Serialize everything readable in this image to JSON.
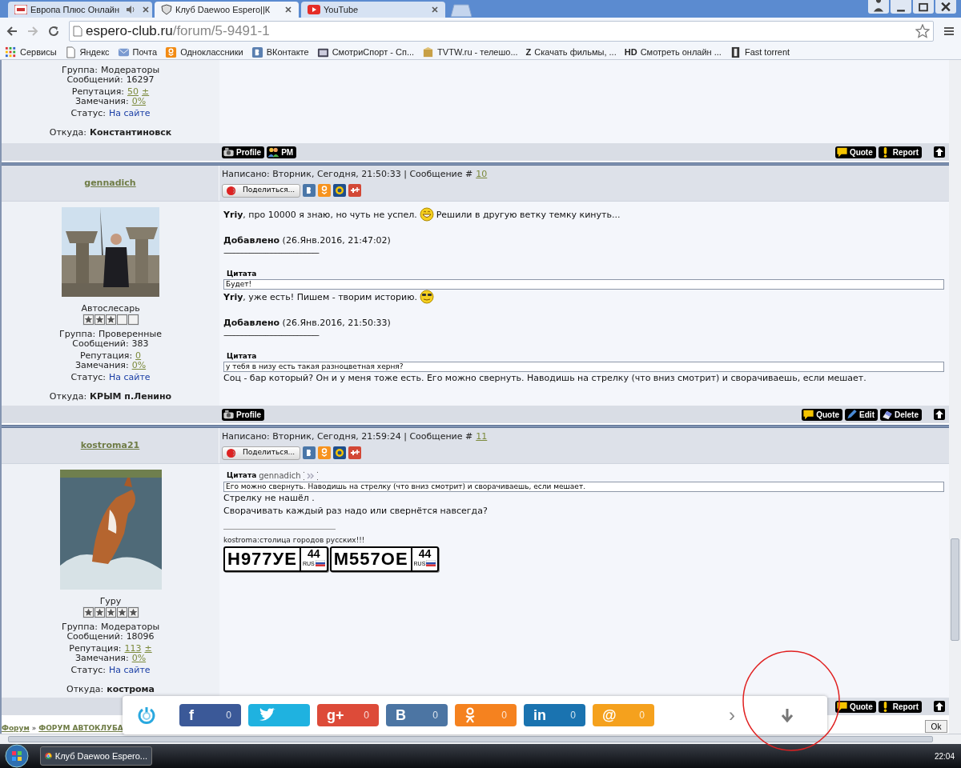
{
  "browser": {
    "tabs": [
      {
        "title": "Европа Плюс Онлайн",
        "kind": "europa",
        "audio": true,
        "selected": false
      },
      {
        "title": "Клуб Daewoo Espero||К",
        "kind": "shield",
        "audio": false,
        "selected": true
      },
      {
        "title": "YouTube",
        "kind": "youtube",
        "audio": false,
        "selected": false
      }
    ],
    "address": {
      "domain": "espero-club.ru",
      "path": "/forum/5-9491-1"
    },
    "bookmarks": [
      {
        "label": "Сервисы",
        "kind": "apps"
      },
      {
        "label": "Яндекс",
        "kind": "page"
      },
      {
        "label": "Почта",
        "kind": "mail"
      },
      {
        "label": "Одноклассники",
        "kind": "ok"
      },
      {
        "label": "ВКонтакте",
        "kind": "vk"
      },
      {
        "label": "СмотриСпорт - Сп...",
        "kind": "tv"
      },
      {
        "label": "TVTW.ru - телешо...",
        "kind": "box"
      },
      {
        "label": "Скачать фильмы, ...",
        "glyph": "Z"
      },
      {
        "label": "Смотреть онлайн ...",
        "glyph": "HD"
      },
      {
        "label": "Fast torrent",
        "kind": "film"
      }
    ]
  },
  "posts": [
    {
      "profile": {
        "fields": [
          [
            {
              "label": "Группа:",
              "value": "Модераторы",
              "kind": "plain"
            },
            {
              "label": "Сообщений:",
              "value": "16297",
              "kind": "plain"
            }
          ],
          [
            {
              "label": "Репутация:",
              "value": "50",
              "suffix": "±",
              "kind": "link"
            },
            {
              "label": "Замечания:",
              "value": "0%",
              "kind": "link"
            }
          ],
          [
            {
              "label": "Статус:",
              "value": "На сайте",
              "kind": "status"
            }
          ],
          [
            {
              "label": "Откуда:",
              "value": "Константиновск",
              "kind": "bold"
            }
          ]
        ]
      },
      "left_actions": [
        {
          "label": "Profile",
          "kind": "profile"
        },
        {
          "label": "PM",
          "kind": "pm"
        }
      ],
      "right_actions": [
        {
          "label": "Quote",
          "kind": "quote"
        },
        {
          "label": "Report",
          "kind": "report"
        }
      ]
    },
    {
      "author": "gennadich",
      "posted": "Написано: Вторник, Сегодня, 21:50:33 | Сообщение #",
      "number": "10",
      "share": "Поделиться...",
      "profile": {
        "avatar": {
          "kind": "picture"
        },
        "rank": "Автослесарь",
        "stars": 3,
        "fields": [
          [
            {
              "label": "Группа:",
              "value": "Проверенные",
              "kind": "plain"
            },
            {
              "label": "Сообщений:",
              "value": "383",
              "kind": "plain"
            }
          ],
          [
            {
              "label": "Репутация:",
              "value": "0",
              "kind": "link"
            },
            {
              "label": "Замечания:",
              "value": "0%",
              "kind": "link"
            }
          ],
          [
            {
              "label": "Статус:",
              "value": "На сайте",
              "kind": "status"
            }
          ],
          [
            {
              "label": "Откуда:",
              "value": "КРЫМ п.Ленино",
              "kind": "bold"
            }
          ]
        ]
      },
      "content": [
        {
          "kind": "text",
          "text": "**Yriy**, про 10000 я знаю, но чуть не успел.",
          "smiley": true,
          "tail": "Решили в другую ветку темку кинуть..."
        },
        {
          "kind": "added",
          "label": "Добавлено",
          "date": "(26.Янв.2016, 21:47:02)"
        },
        {
          "kind": "dashes",
          "text": "------------------------------------------------"
        },
        {
          "kind": "quote",
          "title": "Цитата",
          "text": "Будет!"
        },
        {
          "kind": "text",
          "text": "**Yriy**, уже есть! Пишем - творим историю.",
          "smiley": true
        },
        {
          "kind": "added",
          "label": "Добавлено",
          "date": "(26.Янв.2016, 21:50:33)"
        },
        {
          "kind": "dashes",
          "text": "------------------------------------------------"
        },
        {
          "kind": "quote",
          "title": "Цитата",
          "text": "у тебя в низу есть такая разноцветная херня?"
        },
        {
          "kind": "text",
          "text": "Соц - бар который? Он и у меня тоже есть. Его можно свернуть. Наводишь на стрелку (что вниз смотрит) и сворачиваешь, если мешает."
        }
      ],
      "left_actions": [
        {
          "label": "Profile",
          "kind": "profile"
        }
      ],
      "right_actions": [
        {
          "label": "Quote",
          "kind": "quote"
        },
        {
          "label": "Edit",
          "kind": "edit"
        },
        {
          "label": "Delete",
          "kind": "delete"
        }
      ]
    },
    {
      "author": "kostroma21",
      "posted": "Написано: Вторник, Сегодня, 21:59:24 | Сообщение #",
      "number": "11",
      "share": "Поделиться...",
      "profile": {
        "avatar": {
          "kind": "picture"
        },
        "rank": "Гуру",
        "stars": 5,
        "fields": [
          [
            {
              "label": "Группа:",
              "value": "Модераторы",
              "kind": "plain"
            },
            {
              "label": "Сообщений:",
              "value": "18096",
              "kind": "plain"
            }
          ],
          [
            {
              "label": "Репутация:",
              "value": "113",
              "suffix": "±",
              "kind": "link"
            },
            {
              "label": "Замечания:",
              "value": "0%",
              "kind": "link"
            }
          ],
          [
            {
              "label": "Статус:",
              "value": "На сайте",
              "kind": "status"
            }
          ],
          [
            {
              "label": "Откуда:",
              "value": "кострома",
              "kind": "bold"
            }
          ]
        ]
      },
      "content": [
        {
          "kind": "quote",
          "title": "Цитата",
          "author": "gennadich",
          "text": "Его можно свернуть. Наводишь на стрелку (что вниз смотрит) и сворачиваешь, если мешает."
        },
        {
          "kind": "text",
          "text": "Стрелку не нашёл ."
        },
        {
          "kind": "text",
          "text": "Сворачивать каждый раз надо или свернётся навсегда?"
        },
        {
          "kind": "signature",
          "text": "kostroma:столица городов русских!!!"
        },
        {
          "kind": "plates",
          "plates": [
            {
              "number": "Н977УЕ",
              "region": "44",
              "country": "RUS"
            },
            {
              "number": "М557ОЕ",
              "region": "44",
              "country": "RUS"
            }
          ]
        }
      ],
      "right_actions": [
        {
          "label": "Quote",
          "kind": "quote"
        },
        {
          "label": "Report",
          "kind": "report"
        }
      ]
    }
  ],
  "breadcrumb": [
    {
      "text": "Форум",
      "kind": "link"
    },
    {
      "text": "»",
      "kind": "sep"
    },
    {
      "text": "ФОРУМ АВТОКЛУБА",
      "kind": "link"
    }
  ],
  "share_bar": {
    "buttons": [
      {
        "kind": "glyph",
        "glyph": "f",
        "count": "0",
        "color": "#3b5998"
      },
      {
        "kind": "twitter",
        "color": "#1fb2e0"
      },
      {
        "kind": "glyph",
        "glyph": "g+",
        "count": "0",
        "color": "#dd4b39"
      },
      {
        "kind": "glyph",
        "glyph": "B",
        "count": "0",
        "color": "#4c75a3"
      },
      {
        "kind": "odnoklassniki",
        "count": "0",
        "color": "#f5821f"
      },
      {
        "kind": "glyph",
        "glyph": "in",
        "count": "0",
        "color": "#1a73b0"
      },
      {
        "kind": "glyph",
        "glyph": "@",
        "count": "0",
        "color": "#f5a11d"
      }
    ],
    "next_glyph": "›"
  },
  "ok_button": "Ok",
  "taskbar": {
    "tasks": [
      {
        "title": "Клуб Daewoo Espero..."
      }
    ],
    "clock": "22:04"
  }
}
